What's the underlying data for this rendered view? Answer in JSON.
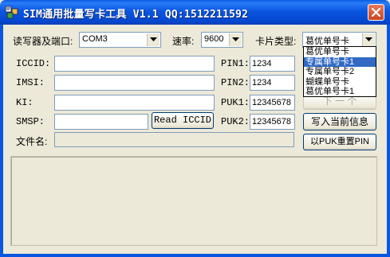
{
  "window": {
    "title": "SIM通用批量写卡工具 V1.1   QQ:1512211592",
    "colors": {
      "title_bar": "#0a56e0",
      "close_button": "#d2553a",
      "dialog_bg": "#ece9d8",
      "selection": "#316ac5"
    }
  },
  "top_row": {
    "port_label": "读写器及端口:",
    "port_value": "COM3",
    "rate_label": "速率:",
    "rate_value": "9600",
    "card_type_label": "卡片类型:",
    "card_type_value": "葛优单号卡"
  },
  "card_type_options": [
    "葛优单号卡",
    "专属单号卡1",
    "专属单号卡2",
    "蝴蝶单号卡",
    "葛优单号卡1"
  ],
  "card_type_highlighted": "专属单号卡1",
  "fields": {
    "iccid_label": "ICCID:",
    "iccid_value": "",
    "imsi_label": "IMSI:",
    "imsi_value": "",
    "ki_label": "KI:",
    "ki_value": "",
    "smsp_label": "SMSP:",
    "smsp_value": "",
    "filename_label": "文件名:",
    "filename_value": ""
  },
  "pins": {
    "pin1_label": "PIN1:",
    "pin1_value": "1234",
    "pin2_label": "PIN2:",
    "pin2_value": "1234",
    "puk1_label": "PUK1:",
    "puk1_value": "12345678",
    "puk2_label": "PUK2:",
    "puk2_value": "12345678"
  },
  "buttons": {
    "read_iccid": "Read ICCID",
    "next": "下 一 个",
    "write_info": "写入当前信息",
    "reset_pin": "以PUK重置PIN"
  },
  "log": {
    "text": ""
  }
}
